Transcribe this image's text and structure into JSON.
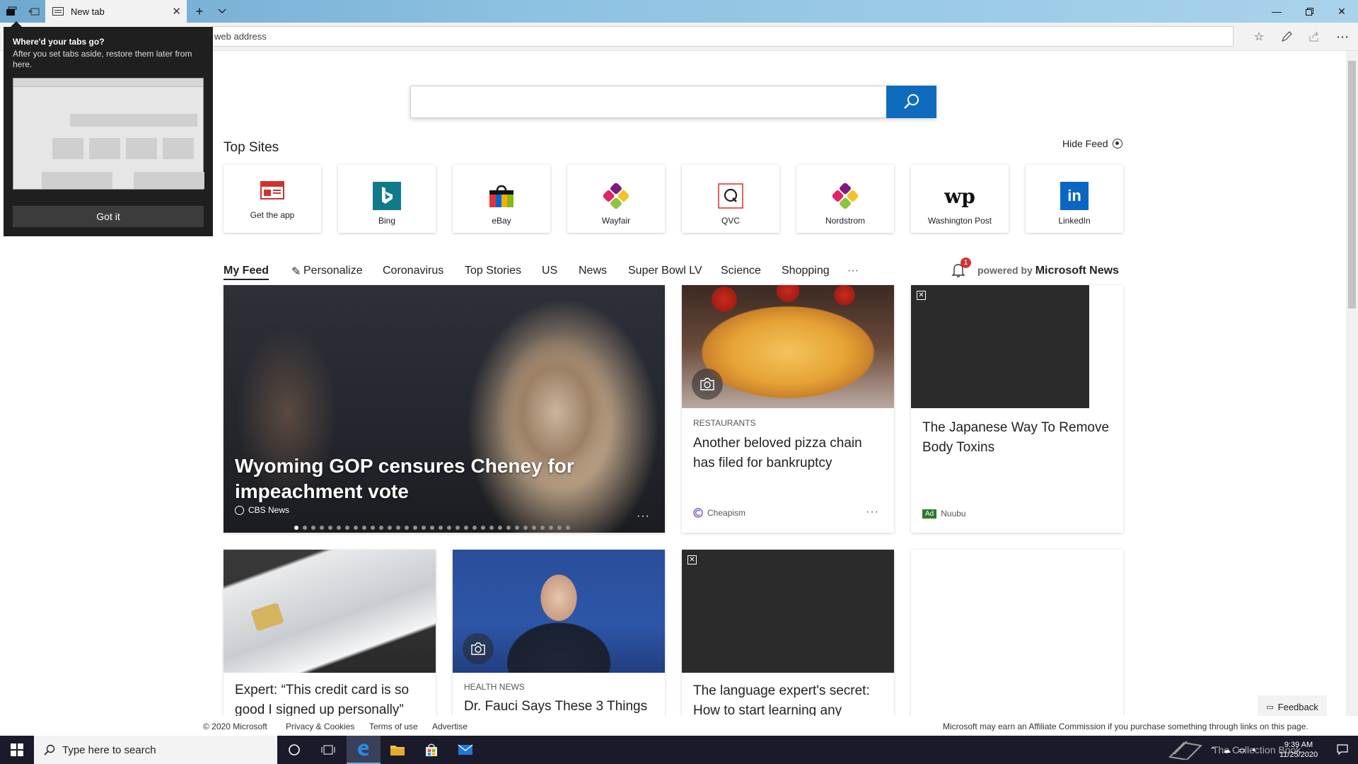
{
  "browser": {
    "tab_title": "New tab",
    "address_placeholder": "web address"
  },
  "flyout": {
    "title": "Where'd your tabs go?",
    "body": "After you set tabs aside, restore them later from here.",
    "button": "Got it"
  },
  "top_sites": {
    "title": "Top Sites",
    "hide_feed": "Hide Feed",
    "items": [
      {
        "label": "Get the app",
        "icon": "msn-app-icon"
      },
      {
        "label": "Bing",
        "icon": "bing-icon"
      },
      {
        "label": "eBay",
        "icon": "ebay-bag-icon"
      },
      {
        "label": "Wayfair",
        "icon": "wayfair-icon"
      },
      {
        "label": "QVC",
        "icon": "qvc-icon"
      },
      {
        "label": "Nordstrom",
        "icon": "nordstrom-icon"
      },
      {
        "label": "Washington Post",
        "icon": "wapo-icon"
      },
      {
        "label": "LinkedIn",
        "icon": "linkedin-icon"
      }
    ]
  },
  "feed_nav": {
    "items": [
      "My Feed",
      "Personalize",
      "Coronavirus",
      "Top Stories",
      "US",
      "News",
      "Super Bowl LV",
      "Science",
      "Shopping"
    ],
    "more": "···",
    "notification_count": "1",
    "powered_prefix": "powered by",
    "powered_brand": "Microsoft News"
  },
  "cards": {
    "hero": {
      "title": "Wyoming GOP censures Cheney for impeachment vote",
      "source": "CBS News",
      "more": "···"
    },
    "pizza": {
      "category": "RESTAURANTS",
      "title": "Another beloved pizza chain has filed for bankruptcy",
      "source": "Cheapism",
      "more": "···"
    },
    "ad1": {
      "title": "The Japanese Way To Remove Body Toxins",
      "ad_tag": "Ad",
      "source": "Nuubu"
    },
    "card": {
      "title": "Expert: “This credit card is so good I signed up personally”"
    },
    "fauci": {
      "category": "HEALTH NEWS",
      "title": "Dr. Fauci Says These 3 Things"
    },
    "lang": {
      "title": "The language expert's secret: How to start learning any"
    }
  },
  "footer": {
    "copyright": "© 2020 Microsoft",
    "privacy": "Privacy & Cookies",
    "terms": "Terms of use",
    "advertise": "Advertise",
    "affiliate": "Microsoft may earn an Affiliate Commission if you purchase something through links on this page.",
    "feedback": "Feedback"
  },
  "taskbar": {
    "search_placeholder": "Type here to search",
    "time": "9:39 AM",
    "date": "11/25/2020",
    "watermark": "The Collection Book"
  },
  "colors": {
    "accent": "#0f6cbd",
    "badge": "#d13438",
    "ad_tag": "#2b7a2b"
  }
}
